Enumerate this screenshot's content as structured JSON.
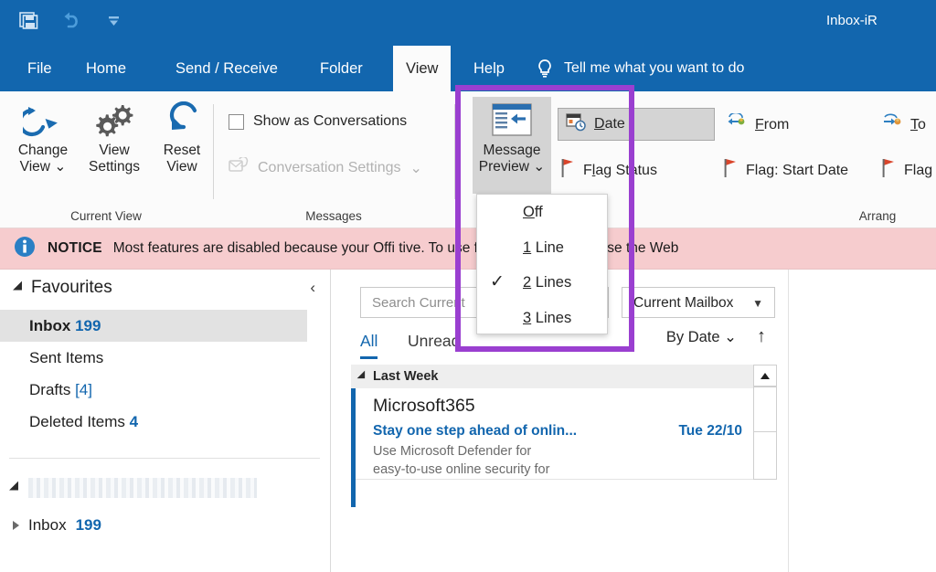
{
  "window": {
    "title": "Inbox-iR",
    "quick_access": [
      {
        "name": "save-icon",
        "label": "Save"
      },
      {
        "name": "undo-icon",
        "label": "Undo"
      },
      {
        "name": "customize-qat-icon",
        "label": "Customize Quick Access Toolbar"
      }
    ]
  },
  "ribbon": {
    "tabs": [
      {
        "label": "File",
        "active": false
      },
      {
        "label": "Home",
        "active": false
      },
      {
        "label": "Send / Receive",
        "active": false
      },
      {
        "label": "Folder",
        "active": false
      },
      {
        "label": "View",
        "active": true
      },
      {
        "label": "Help",
        "active": false
      }
    ],
    "tell_me": "Tell me what you want to do",
    "groups": [
      {
        "name": "current-view",
        "label": "Current View"
      },
      {
        "name": "messages",
        "label": "Messages"
      },
      {
        "name": "arrangement",
        "label": "Arrang"
      }
    ],
    "current_view": {
      "change_view": "Change\nView",
      "change_view_line1": "Change",
      "change_view_line2": "View",
      "view_settings_line1": "View",
      "view_settings_line2": "Settings",
      "reset_view_line1": "Reset",
      "reset_view_line2": "View"
    },
    "messages": {
      "show_as_conversations": "Show as Conversations",
      "show_as_conversations_checked": false,
      "conversation_settings": "Conversation Settings",
      "conversation_settings_disabled": true
    },
    "message_preview": {
      "label_line1": "Message",
      "label_line2": "Preview",
      "expanded": true,
      "options": [
        {
          "label": "Off",
          "accel": "O",
          "checked": false
        },
        {
          "label": "1 Line",
          "accel": "1",
          "checked": false
        },
        {
          "label": "2 Lines",
          "accel": "2",
          "checked": true
        },
        {
          "label": "3 Lines",
          "accel": "3",
          "checked": false
        }
      ]
    },
    "arrangement": {
      "items": [
        {
          "label": "Date",
          "accel": "D",
          "selected": true,
          "icon": "date-icon"
        },
        {
          "label": "From",
          "accel": "F",
          "selected": false,
          "icon": "from-icon"
        },
        {
          "label": "To",
          "accel": "T",
          "selected": false,
          "icon": "to-icon"
        },
        {
          "label": "Flag Status",
          "accel": "l",
          "selected": false,
          "icon": "flag-icon"
        },
        {
          "label": "Flag: Start Date",
          "accel": "g",
          "selected": false,
          "icon": "flag-icon"
        },
        {
          "label": "Flag",
          "accel": "",
          "selected": false,
          "icon": "flag-icon"
        }
      ]
    }
  },
  "notice": {
    "badge": "NOTICE",
    "text": "Most features are disabled because your Offi                              tive. To use for free, sign in and use the Web"
  },
  "sidebar": {
    "favourites_header": "Favourites",
    "collapse_icon": "‹",
    "items": [
      {
        "label": "Inbox",
        "count": "199",
        "selected": true,
        "bracket": false
      },
      {
        "label": "Sent Items",
        "count": "",
        "selected": false,
        "bracket": false
      },
      {
        "label": "Drafts",
        "count": "[4]",
        "selected": false,
        "bracket": true
      },
      {
        "label": "Deleted Items",
        "count": "4",
        "selected": false,
        "bracket": false
      }
    ],
    "account_redacted": true,
    "account_inbox": {
      "label": "Inbox",
      "count": "199"
    }
  },
  "message_pane": {
    "search_placeholder": "Search Current",
    "mailbox_scope": "Current Mailbox",
    "filters": [
      {
        "label": "All",
        "active": true
      },
      {
        "label": "Unread",
        "active": false
      }
    ],
    "sort_by": "By Date",
    "sort_direction": "↑",
    "group_header": "Last Week",
    "messages": [
      {
        "sender": "Microsoft365",
        "subject": "Stay one step ahead of onlin...",
        "date": "Tue 22/10",
        "preview_line1": "Use Microsoft Defender for",
        "preview_line2": "easy-to-use online security for",
        "unread": true
      }
    ]
  },
  "colors": {
    "title_blue": "#1266ae",
    "accent_blue": "#1266ae",
    "highlight_purple": "#9a3fd0",
    "notice_pink": "#f6ccce",
    "ribbon_bg": "#fbfbfb",
    "selection_grey": "#d4d4d4"
  }
}
